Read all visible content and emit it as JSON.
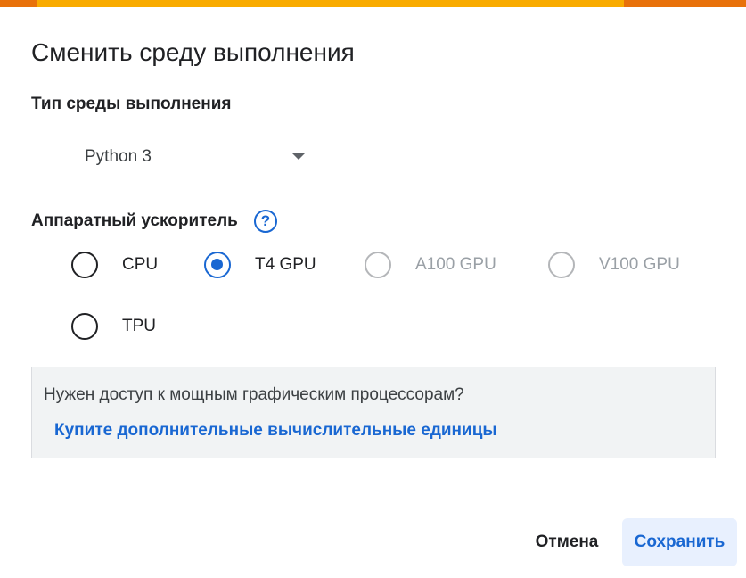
{
  "dialog": {
    "title": "Сменить среду выполнения",
    "runtime_type": {
      "label": "Тип среды выполнения",
      "selected": "Python 3"
    },
    "accelerator": {
      "label": "Аппаратный ускоритель",
      "help_icon": "help-circle-icon",
      "help_glyph": "?",
      "options": [
        {
          "label": "CPU",
          "selected": false,
          "enabled": true
        },
        {
          "label": "T4 GPU",
          "selected": true,
          "enabled": true
        },
        {
          "label": "A100 GPU",
          "selected": false,
          "enabled": false
        },
        {
          "label": "V100 GPU",
          "selected": false,
          "enabled": false
        },
        {
          "label": "TPU",
          "selected": false,
          "enabled": true
        }
      ]
    },
    "info_box": {
      "text": "Нужен доступ к мощным графическим процессорам?",
      "link": "Купите дополнительные вычислительные единицы"
    },
    "buttons": {
      "cancel": "Отмена",
      "save": "Сохранить"
    }
  },
  "colors": {
    "accent": "#1967d2",
    "top_strip_orange": "#f9ab00",
    "top_strip_dark_orange": "#e8710a",
    "disabled": "#9aa0a6"
  }
}
